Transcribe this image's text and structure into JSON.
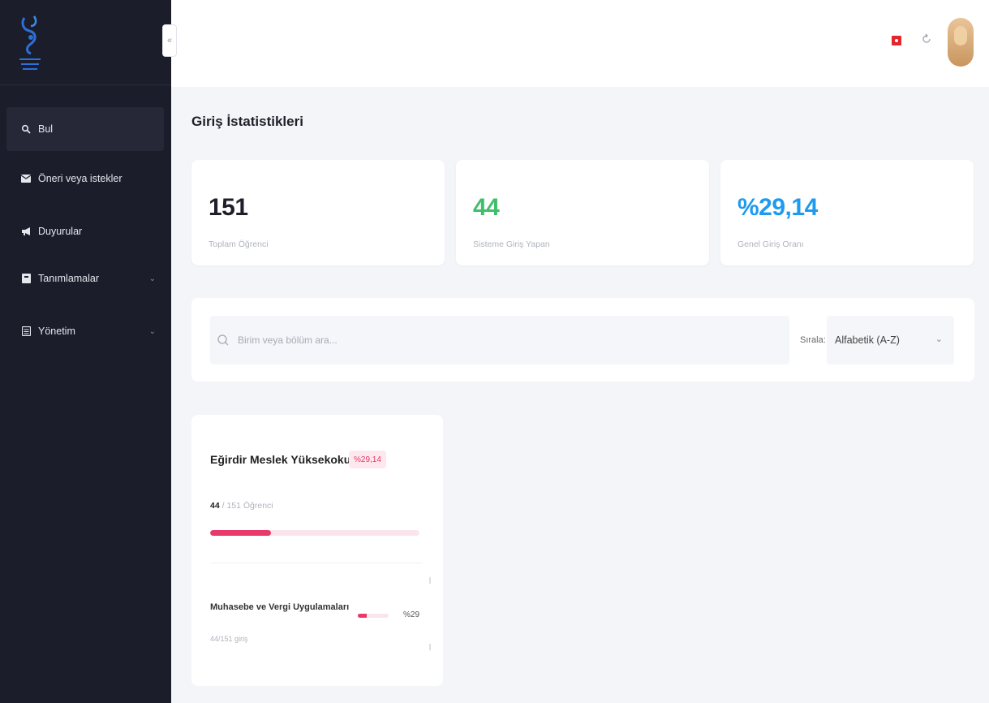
{
  "sidebar": {
    "items": [
      {
        "label": "Bul",
        "icon": "search-icon"
      },
      {
        "label": "Öneri veya istekler",
        "icon": "envelope-icon"
      },
      {
        "label": "Duyurular",
        "icon": "megaphone-icon"
      },
      {
        "label": "Tanımlamalar",
        "icon": "book-icon"
      },
      {
        "label": "Yönetim",
        "icon": "document-icon"
      }
    ]
  },
  "header": {
    "flag_icon": "turkey-flag-icon",
    "refresh_icon": "refresh-icon",
    "avatar_icon": "user-avatar"
  },
  "main": {
    "title": "Giriş İstatistikleri",
    "stats": [
      {
        "value": "151",
        "label": "Toplam Öğrenci",
        "color": "#1f1f2a"
      },
      {
        "value": "44",
        "label": "Sisteme Giriş Yapan",
        "color": "#3fbf6a"
      },
      {
        "value": "%29,14",
        "label": "Genel Giriş Oranı",
        "color": "#1e9bf0"
      }
    ],
    "search": {
      "placeholder": "Birim veya bölüm ara..."
    },
    "sort": {
      "label": "Sırala:",
      "value": "Alfabetik (A-Z)"
    }
  },
  "unit": {
    "name": "Eğirdir Meslek Yüksekokulu",
    "rate": "%29,14",
    "count_bold": "44",
    "count_rest": " / 151 Öğrenci",
    "progress": 0.2914,
    "dept": {
      "name": "Muhasebe ve Vergi Uygulamaları",
      "sub": "44/151 giriş",
      "pct": "%29",
      "progress": 0.29
    }
  },
  "colors": {
    "accent": "#e8396a",
    "sidebar": "#1c1d2b"
  }
}
